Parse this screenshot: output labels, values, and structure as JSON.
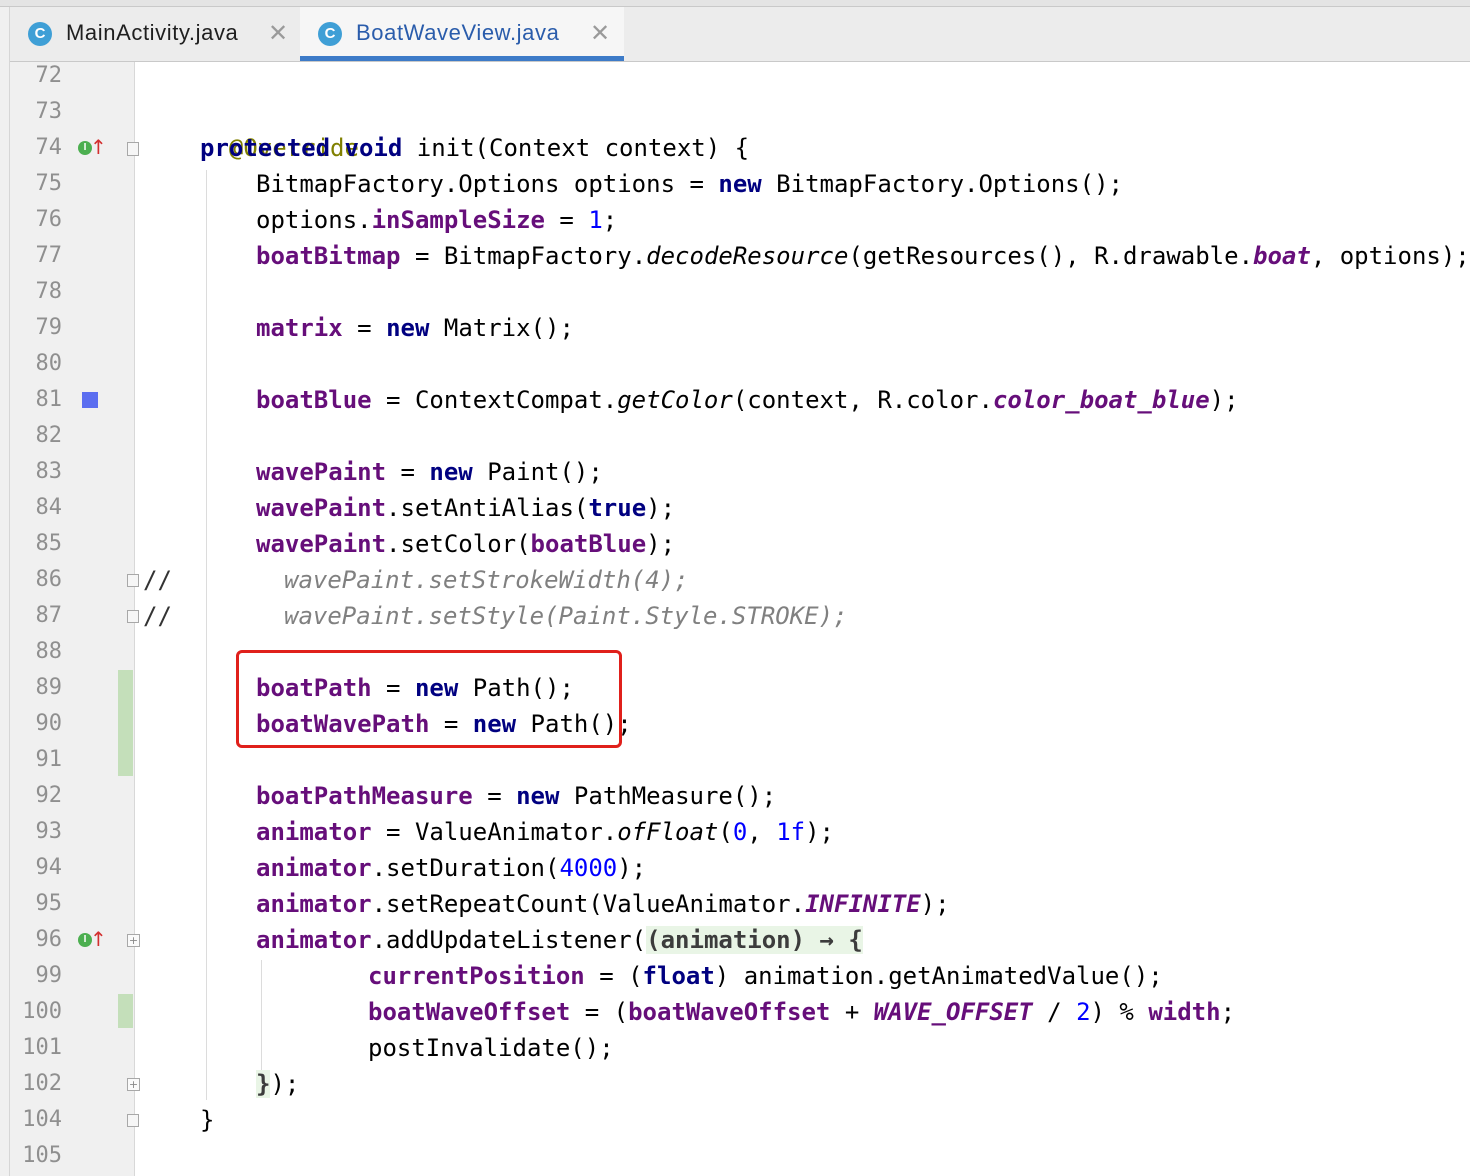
{
  "tabs": [
    {
      "icon_letter": "C",
      "label": "MainActivity.java",
      "close": "✕",
      "active": false
    },
    {
      "icon_letter": "C",
      "label": "BoatWaveView.java",
      "close": "✕",
      "active": true
    }
  ],
  "line_numbers": [
    "72",
    "73",
    "74",
    "75",
    "76",
    "77",
    "78",
    "79",
    "80",
    "81",
    "82",
    "83",
    "84",
    "85",
    "86",
    "87",
    "88",
    "89",
    "90",
    "91",
    "92",
    "93",
    "94",
    "95",
    "96",
    "99",
    "100",
    "101",
    "102",
    "104",
    "105"
  ],
  "gutter": {
    "implements_icon_letter": "I",
    "override_arrow": "↑",
    "fold_plus": "+",
    "comment_marker": "//"
  },
  "code": {
    "l73": {
      "annotation": "@Override"
    },
    "l74": {
      "kw1": "protected",
      "kw2": "void",
      "rest": " init(Context context) {"
    },
    "l75": {
      "a": "BitmapFactory.Options options = ",
      "kw": "new",
      "b": " BitmapFactory.Options();"
    },
    "l76": {
      "a": "options.",
      "fld": "inSampleSize",
      "b": " = ",
      "num": "1",
      "c": ";"
    },
    "l77": {
      "fld": "boatBitmap",
      "a": " = BitmapFactory.",
      "method": "decodeResource",
      "b": "(getResources(), R.drawable.",
      "cfld": "boat",
      "c": ", options);"
    },
    "l79": {
      "fld": "matrix",
      "a": " = ",
      "kw": "new",
      "b": " Matrix();"
    },
    "l81": {
      "fld": "boatBlue",
      "a": " = ContextCompat.",
      "method": "getColor",
      "b": "(context, R.color.",
      "cfld": "color_boat_blue",
      "c": ");"
    },
    "l83": {
      "fld": "wavePaint",
      "a": " = ",
      "kw": "new",
      "b": " Paint();"
    },
    "l84": {
      "fld": "wavePaint",
      "a": ".setAntiAlias(",
      "kw": "true",
      "b": ");"
    },
    "l85": {
      "fld": "wavePaint",
      "a": ".setColor(",
      "fld2": "boatBlue",
      "b": ");"
    },
    "l86": {
      "comment": "wavePaint.setStrokeWidth(4);"
    },
    "l87": {
      "comment": "wavePaint.setStyle(Paint.Style.STROKE);"
    },
    "l89": {
      "fld": "boatPath",
      "a": " = ",
      "kw": "new",
      "b": " Path();"
    },
    "l90": {
      "fld": "boatWavePath",
      "a": " = ",
      "kw": "new",
      "b": " Path();"
    },
    "l92": {
      "fld": "boatPathMeasure",
      "a": " = ",
      "kw": "new",
      "b": " PathMeasure();"
    },
    "l93": {
      "fld": "animator",
      "a": " = ValueAnimator.",
      "method": "ofFloat",
      "b": "(",
      "num1": "0",
      "c": ", ",
      "num2": "1f",
      "d": ");"
    },
    "l94": {
      "fld": "animator",
      "a": ".setDuration(",
      "num": "4000",
      "b": ");"
    },
    "l95": {
      "fld": "animator",
      "a": ".setRepeatCount(ValueAnimator.",
      "cfld": "INFINITE",
      "b": ");"
    },
    "l96": {
      "fld": "animator",
      "a": ".addUpdateListener(",
      "lambda": "(animation) → {"
    },
    "l99": {
      "fld": "currentPosition",
      "a": " = (",
      "kw": "float",
      "b": ") animation.getAnimatedValue();"
    },
    "l100": {
      "fld": "boatWaveOffset",
      "a": " = (",
      "fld2": "boatWaveOffset",
      "b": " + ",
      "cfld": "WAVE_OFFSET",
      "c": " / ",
      "num": "2",
      "d": ") % ",
      "fld3": "width",
      "e": ";"
    },
    "l101": {
      "a": "postInvalidate();"
    },
    "l102": {
      "lambda_close": "}",
      "a": ");"
    },
    "l104": {
      "a": "}"
    }
  },
  "colors": {
    "keyword": "#000080",
    "field": "#660e7a",
    "annotation": "#808000",
    "number": "#0000ff",
    "comment": "#808080",
    "highlight_box": "#e0201b",
    "change_marker": "#c4dfba",
    "tab_underline": "#3d7bc8"
  }
}
